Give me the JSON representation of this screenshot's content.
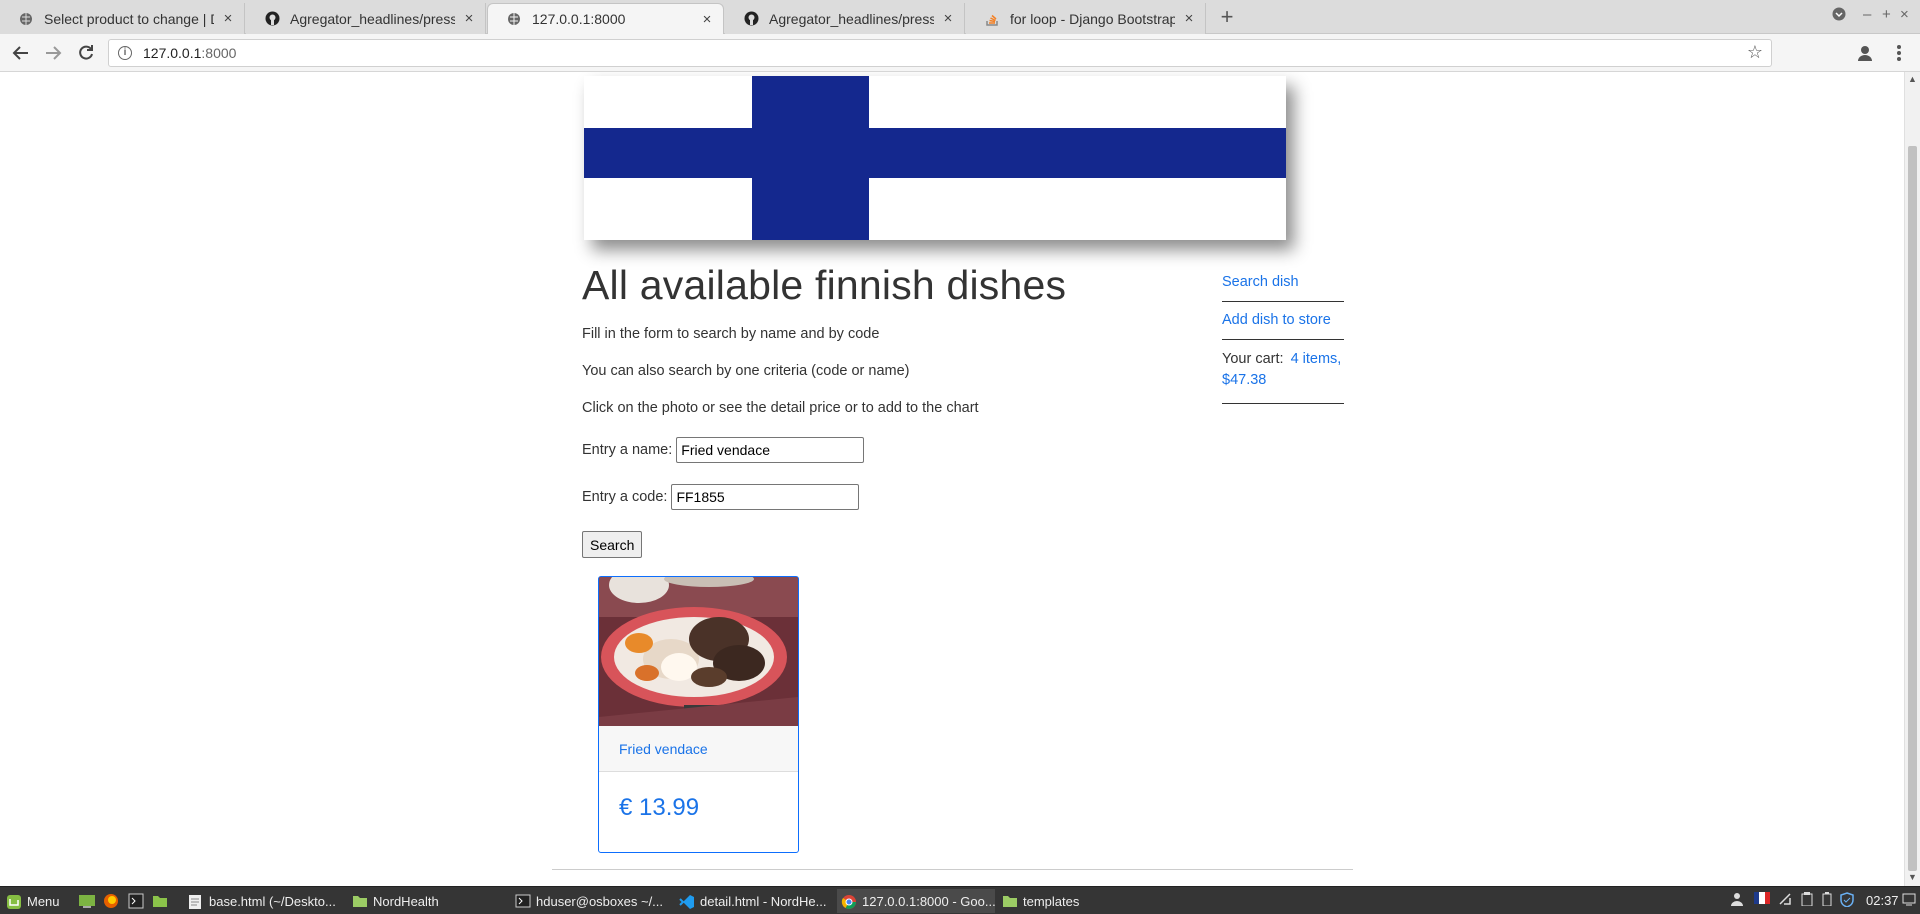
{
  "browser": {
    "tabs": [
      {
        "title": "Select product to change | Django",
        "icon": "globe-icon",
        "active": false
      },
      {
        "title": "Agregator_headlines/presses_fr",
        "icon": "github-icon",
        "active": false
      },
      {
        "title": "127.0.0.1:8000",
        "icon": "globe-icon",
        "active": true
      },
      {
        "title": "Agregator_headlines/presses_fr",
        "icon": "github-icon",
        "active": false
      },
      {
        "title": "for loop - Django Bootstrap card",
        "icon": "stackoverflow-icon",
        "active": false
      }
    ],
    "close_glyph": "×",
    "new_tab_glyph": "+",
    "url_host": "127.0.0.1",
    "url_port": ":8000",
    "window_controls": [
      "–",
      "+",
      "×"
    ]
  },
  "page": {
    "banner_colors": {
      "blue": "#14288e",
      "white": "#ffffff"
    },
    "heading": "All available finnish dishes",
    "instructions": [
      "Fill in the form to search by name and by code",
      "You can also search by one criteria (code or name)",
      "Click on the photo or see the detail price or to add to the chart"
    ],
    "form": {
      "name_label": "Entry a name:",
      "name_value": "Fried vendace",
      "code_label": "Entry a code:",
      "code_value": "FF1855",
      "search_label": "Search"
    },
    "card": {
      "title": "Fried vendace",
      "price": "€ 13.99"
    },
    "sidebar": {
      "search_link": "Search dish",
      "add_link": "Add dish to store",
      "cart_label": "Your cart:",
      "cart_items": "4 items,",
      "cart_total": "$47.38"
    }
  },
  "taskbar": {
    "menu_label": "Menu",
    "windows": [
      {
        "label": "base.html (~/Deskto...",
        "icon": "text-editor-icon",
        "active": false
      },
      {
        "label": "NordHealth",
        "icon": "folder-icon",
        "active": false
      },
      {
        "label": "hduser@osboxes ~/...",
        "icon": "terminal-icon",
        "active": false
      },
      {
        "label": "detail.html - NordHe...",
        "icon": "vscode-icon",
        "active": false
      },
      {
        "label": "127.0.0.1:8000 - Goo...",
        "icon": "chrome-icon",
        "active": true
      },
      {
        "label": "templates",
        "icon": "folder-icon",
        "active": false
      }
    ],
    "clock": "02:37"
  }
}
